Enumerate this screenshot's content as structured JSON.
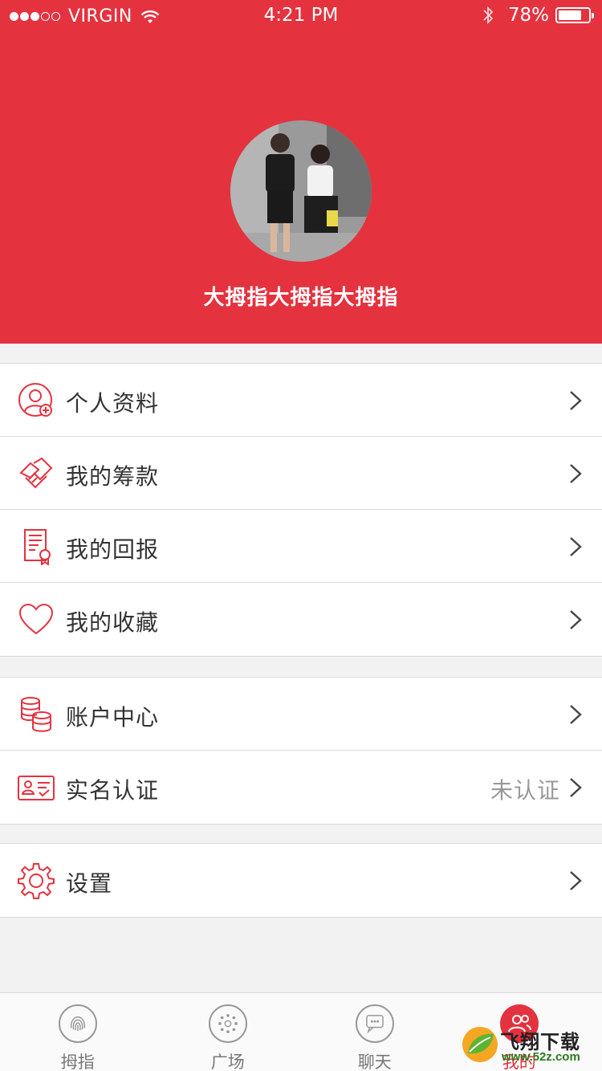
{
  "status_bar": {
    "carrier": "VIRGIN",
    "time": "4:21 PM",
    "battery_percent": "78%",
    "battery_level": 0.78,
    "signal_bars_filled": 3,
    "signal_bars_total": 5
  },
  "profile": {
    "username": "大拇指大拇指大拇指"
  },
  "menu": {
    "group1": [
      {
        "label": "个人资料",
        "icon": "user-add-icon"
      },
      {
        "label": "我的筹款",
        "icon": "handshake-icon"
      },
      {
        "label": "我的回报",
        "icon": "certificate-icon"
      },
      {
        "label": "我的收藏",
        "icon": "heart-icon"
      }
    ],
    "group2": [
      {
        "label": "账户中心",
        "icon": "coins-icon"
      },
      {
        "label": "实名认证",
        "icon": "id-card-icon",
        "value": "未认证"
      }
    ],
    "group3": [
      {
        "label": "设置",
        "icon": "gear-icon"
      }
    ]
  },
  "tabbar": {
    "tabs": [
      {
        "label": "拇指",
        "icon": "fingerprint-icon",
        "active": false
      },
      {
        "label": "广场",
        "icon": "dots-circle-icon",
        "active": false
      },
      {
        "label": "聊天",
        "icon": "chat-icon",
        "active": false
      },
      {
        "label": "我的",
        "icon": "users-icon",
        "active": true
      }
    ]
  },
  "watermark": {
    "text": "飞翔下载",
    "url": "www.52z.com"
  },
  "colors": {
    "brand_red": "#e5323f",
    "background": "#f2f2f2",
    "text": "#333333",
    "muted": "#999999"
  }
}
